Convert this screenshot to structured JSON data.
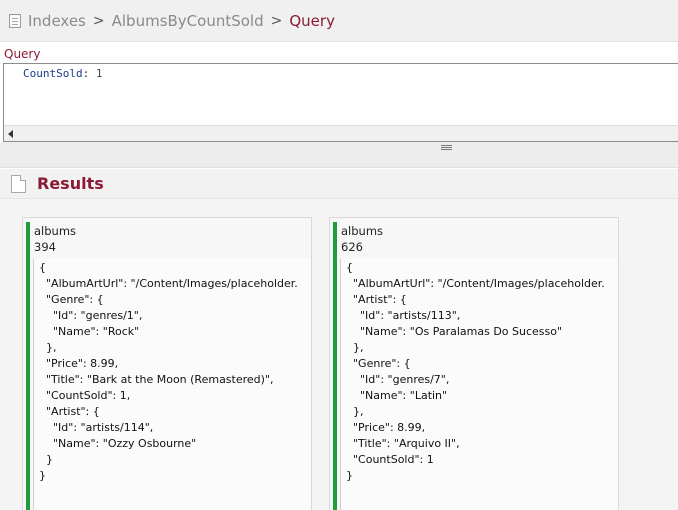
{
  "breadcrumb": {
    "items": [
      "Indexes",
      "AlbumsByCountSold"
    ],
    "separators": [
      ">",
      ">"
    ],
    "current": "Query"
  },
  "query": {
    "label": "Query",
    "key": "CountSold",
    "colon": ":",
    "value": "1"
  },
  "results": {
    "title": "Results",
    "documents": [
      {
        "collection": "albums",
        "id": "394",
        "json_lines": [
          "{",
          "  \"AlbumArtUrl\": \"/Content/Images/placeholder.",
          "  \"Genre\": {",
          "    \"Id\": \"genres/1\",",
          "    \"Name\": \"Rock\"",
          "  },",
          "  \"Price\": 8.99,",
          "  \"Title\": \"Bark at the Moon (Remastered)\",",
          "  \"CountSold\": 1,",
          "  \"Artist\": {",
          "    \"Id\": \"artists/114\",",
          "    \"Name\": \"Ozzy Osbourne\"",
          "  }",
          "}"
        ]
      },
      {
        "collection": "albums",
        "id": "626",
        "json_lines": [
          "{",
          "  \"AlbumArtUrl\": \"/Content/Images/placeholder.",
          "  \"Artist\": {",
          "    \"Id\": \"artists/113\",",
          "    \"Name\": \"Os Paralamas Do Sucesso\"",
          "  },",
          "  \"Genre\": {",
          "    \"Id\": \"genres/7\",",
          "    \"Name\": \"Latin\"",
          "  },",
          "  \"Price\": 8.99,",
          "  \"Title\": \"Arquivo II\",",
          "  \"CountSold\": 1",
          "}"
        ]
      }
    ]
  },
  "colors": {
    "accent": "#8b1a36",
    "card_bar": "#1f9d3a",
    "query_key": "#1a3a8c"
  },
  "icons": [
    "index-page-icon",
    "scroll-left-icon",
    "splitter-grip-icon",
    "results-document-icon"
  ]
}
